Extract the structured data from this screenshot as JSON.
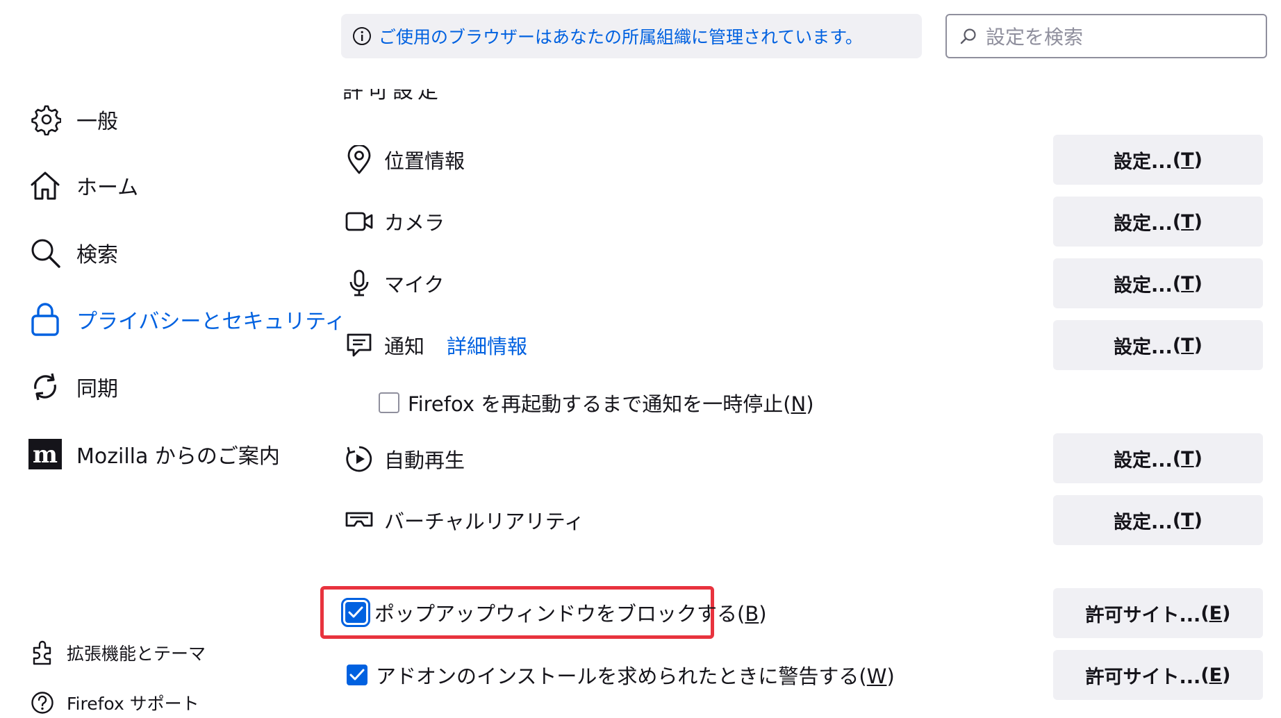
{
  "banner": {
    "text": "ご使用のブラウザーはあなたの所属組織に管理されています。",
    "icon": "info-icon"
  },
  "search": {
    "placeholder": "設定を検索",
    "icon": "search-icon"
  },
  "sidebar": {
    "items": [
      {
        "label": "一般",
        "icon": "gear-icon",
        "active": false
      },
      {
        "label": "ホーム",
        "icon": "home-icon",
        "active": false
      },
      {
        "label": "検索",
        "icon": "search-icon",
        "active": false
      },
      {
        "label": "プライバシーとセキュリティ",
        "icon": "lock-icon",
        "active": true
      },
      {
        "label": "同期",
        "icon": "sync-icon",
        "active": false
      },
      {
        "label": "Mozilla からのご案内",
        "icon": "mozilla-logo-icon",
        "active": false
      }
    ],
    "footer": [
      {
        "label": "拡張機能とテーマ",
        "icon": "puzzle-icon"
      },
      {
        "label": "Firefox サポート",
        "icon": "help-icon"
      }
    ]
  },
  "section": {
    "heading": "許可設定"
  },
  "permissions": [
    {
      "label": "位置情報",
      "icon": "location-pin-icon",
      "button": "設定...",
      "accesskey": "T"
    },
    {
      "label": "カメラ",
      "icon": "camera-icon",
      "button": "設定...",
      "accesskey": "T"
    },
    {
      "label": "マイク",
      "icon": "microphone-icon",
      "button": "設定...",
      "accesskey": "T"
    },
    {
      "label": "通知",
      "icon": "notification-icon",
      "link": "詳細情報",
      "button": "設定...",
      "accesskey": "T"
    },
    {
      "label": "自動再生",
      "icon": "autoplay-icon",
      "button": "設定...",
      "accesskey": "T"
    },
    {
      "label": "バーチャルリアリティ",
      "icon": "vr-headset-icon",
      "button": "設定...",
      "accesskey": "T"
    }
  ],
  "pause_notifications": {
    "label": "Firefox を再起動するまで通知を一時停止",
    "accesskey": "N",
    "checked": false
  },
  "block_popups": {
    "label": "ポップアップウィンドウをブロックする",
    "accesskey": "B",
    "checked": true,
    "button": "許可サイト...",
    "button_accesskey": "E"
  },
  "warn_addons": {
    "label": "アドオンのインストールを求められたときに警告する",
    "accesskey": "W",
    "checked": true,
    "button": "許可サイト...",
    "button_accesskey": "E"
  },
  "colors": {
    "accent": "#0061e0",
    "highlight": "#e8333e",
    "button_bg": "#f0f0f4"
  }
}
